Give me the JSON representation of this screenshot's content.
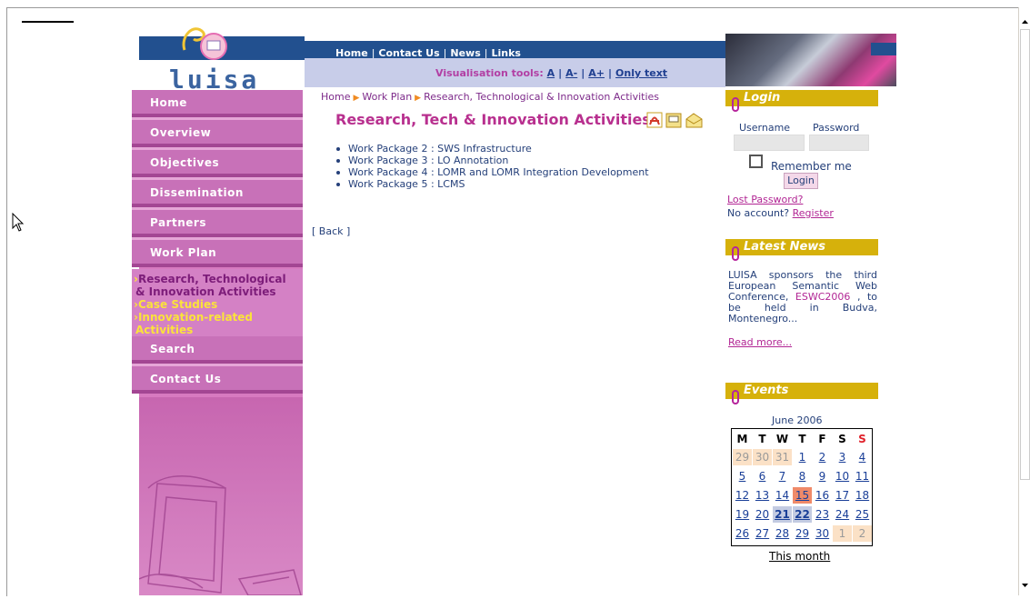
{
  "header": {
    "logo_text": "luisa",
    "top_nav": [
      "Home",
      "Contact Us",
      "News",
      "Links"
    ],
    "viz_label": "Visualisation tools:",
    "viz_links": [
      "A",
      "A-",
      "A+",
      "Only text"
    ]
  },
  "sidebar": {
    "items": [
      {
        "label": "Home"
      },
      {
        "label": "Overview"
      },
      {
        "label": "Objectives"
      },
      {
        "label": "Dissemination"
      },
      {
        "label": "Partners"
      },
      {
        "label": "Work Plan"
      },
      {
        "label": "Search"
      },
      {
        "label": "Contact Us"
      }
    ],
    "sub_items": [
      {
        "line1": "Research, Technological",
        "line2": "& Innovation Activities"
      },
      {
        "line1": "Case Studies"
      },
      {
        "line1": "Innovation-related",
        "line2": "Activities"
      }
    ]
  },
  "breadcrumb": [
    "Home",
    "Work Plan",
    "Research, Technological & Innovation Activities"
  ],
  "main": {
    "title": "Research, Tech & Innovation Activities",
    "work_packages": [
      "Work Package 2 : SWS Infrastructure",
      "Work Package 3 : LO Annotation",
      "Work Package 4 : LOMR and LOMR Integration Development",
      "Work Package 5 : LCMS"
    ],
    "back_label": "[ Back ]"
  },
  "login": {
    "title": "Login",
    "username_label": "Username",
    "password_label": "Password",
    "remember_label": "Remember me",
    "button_label": "Login",
    "lost_password": "Lost Password?",
    "no_account": "No account?",
    "register": "Register"
  },
  "news": {
    "title": "Latest News",
    "text_before": "LUISA sponsors the third European Semantic Web Conference,",
    "link": "ESWC2006",
    "text_after": ", to be held in Budva, Montenegro...",
    "read_more": "Read more..."
  },
  "events": {
    "title": "Events",
    "month": "June 2006",
    "weekdays": [
      "M",
      "T",
      "W",
      "T",
      "F",
      "S",
      "S"
    ],
    "weeks": [
      [
        "29",
        "30",
        "31",
        "1",
        "2",
        "3",
        "4"
      ],
      [
        "5",
        "6",
        "7",
        "8",
        "9",
        "10",
        "11"
      ],
      [
        "12",
        "13",
        "14",
        "15",
        "16",
        "17",
        "18"
      ],
      [
        "19",
        "20",
        "21",
        "22",
        "23",
        "24",
        "25"
      ],
      [
        "26",
        "27",
        "28",
        "29",
        "30",
        "1",
        "2"
      ]
    ],
    "this_month": "This month"
  }
}
